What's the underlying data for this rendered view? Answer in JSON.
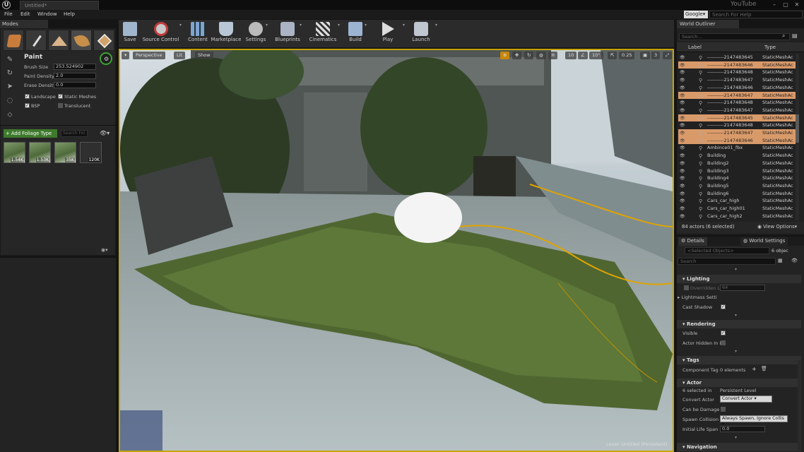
{
  "title_bar": {
    "tab": "Untitled*",
    "badge": "YouTube"
  },
  "menu": [
    "File",
    "Edit",
    "Window",
    "Help"
  ],
  "help": {
    "engine": "Google",
    "placeholder": "Search For Help"
  },
  "modes": {
    "tab": "Modes",
    "paint_title": "Paint",
    "brush_size_label": "Brush Size",
    "brush_size_value": "253.524902",
    "paint_density_label": "Paint Density",
    "paint_density_value": "2.0",
    "erase_density_label": "Erase Density",
    "erase_density_value": "0.0",
    "filters": [
      {
        "label": "Landscape",
        "checked": true
      },
      {
        "label": "Static Meshes",
        "checked": true
      },
      {
        "label": "BSP",
        "checked": true
      },
      {
        "label": "Translucent",
        "checked": false
      }
    ],
    "add_foliage": "+ Add Foliage Type",
    "foliage_search_placeholder": "Search Fol",
    "thumbnails": [
      "1.54K",
      "1.53K",
      "35K",
      "120K"
    ]
  },
  "toolbar": [
    "Save",
    "Source Control",
    "Content",
    "Marketplace",
    "Settings",
    "Blueprints",
    "Cinematics",
    "Build",
    "Play",
    "Launch"
  ],
  "viewport": {
    "perspective": "Perspective",
    "lit": "Lit",
    "show": "Show",
    "grid_snap": "10",
    "rot_snap": "10°",
    "scale_snap": "0.25",
    "cam_speed": "3",
    "level_label": "Level:",
    "level_name": "Untitled (Persistent)"
  },
  "outliner": {
    "tab": "World Outliner",
    "search_placeholder": "Search...",
    "col_label": "Label",
    "col_type": "Type",
    "rows": [
      {
        "label": "----------2147483645",
        "type": "StaticMeshAc",
        "selected": false
      },
      {
        "label": "----------2147483646",
        "type": "StaticMeshAc",
        "selected": true
      },
      {
        "label": "----------2147483648",
        "type": "StaticMeshAc",
        "selected": false
      },
      {
        "label": "----------2147483647",
        "type": "StaticMeshAc",
        "selected": false
      },
      {
        "label": "----------2147483646",
        "type": "StaticMeshAc",
        "selected": false
      },
      {
        "label": "----------2147483647",
        "type": "StaticMeshAc",
        "selected": true
      },
      {
        "label": "----------2147483648",
        "type": "StaticMeshAc",
        "selected": false
      },
      {
        "label": "----------2147483647",
        "type": "StaticMeshAc",
        "selected": false
      },
      {
        "label": "----------2147483645",
        "type": "StaticMeshAc",
        "selected": true
      },
      {
        "label": "----------2147483648",
        "type": "StaticMeshAc",
        "selected": false
      },
      {
        "label": "----------2147483647",
        "type": "StaticMeshAc",
        "selected": true
      },
      {
        "label": "----------2147483646",
        "type": "StaticMeshAc",
        "selected": true
      },
      {
        "label": "Ambince01_fbx",
        "type": "StaticMeshAc",
        "selected": false
      },
      {
        "label": "Building",
        "type": "StaticMeshAc",
        "selected": false
      },
      {
        "label": "Building2",
        "type": "StaticMeshAc",
        "selected": false
      },
      {
        "label": "Building3",
        "type": "StaticMeshAc",
        "selected": false
      },
      {
        "label": "Building4",
        "type": "StaticMeshAc",
        "selected": false
      },
      {
        "label": "Building5",
        "type": "StaticMeshAc",
        "selected": false
      },
      {
        "label": "Building6",
        "type": "StaticMeshAc",
        "selected": false
      },
      {
        "label": "Cars_car_high",
        "type": "StaticMeshAc",
        "selected": false
      },
      {
        "label": "Cars_car_high01",
        "type": "StaticMeshAc",
        "selected": false
      },
      {
        "label": "Cars_car_high2",
        "type": "StaticMeshAc",
        "selected": false
      }
    ],
    "footer": "84 actors (6 selected)",
    "view_options": "View Options"
  },
  "details": {
    "tab": "Details",
    "tab2": "World Settings",
    "selected_objects": "<Selected Objects>",
    "count": "6 objec",
    "search_placeholder": "Search",
    "lighting": "Lighting",
    "lighting_row1_label": "Overridden Li",
    "lighting_row1_value": "64",
    "lightmass": "Lightmass Setti",
    "cast_shadow": "Cast Shadow",
    "rendering": "Rendering",
    "visible": "Visible",
    "hidden_in_game": "Actor Hidden In I",
    "tags": "Tags",
    "component_tags_label": "Component Tag",
    "component_tags_value": "0 elements",
    "actor": "Actor",
    "selected_in_label": "6 selected in",
    "selected_in_value": "Persistent Level",
    "convert_label": "Convert Actor",
    "convert_value": "Convert Actor",
    "can_be_damaged": "Can be Damage",
    "spawn_label": "Spawn Collision",
    "spawn_value": "Always Spawn, Ignore Collis",
    "lifespan_label": "Initial Life Span",
    "lifespan_value": "0.0",
    "navigation": "Navigation"
  },
  "colors": {
    "accent_select": "#d99a6a",
    "viewport_border": "#c6a300",
    "foliage_button": "#3e7a2c"
  }
}
